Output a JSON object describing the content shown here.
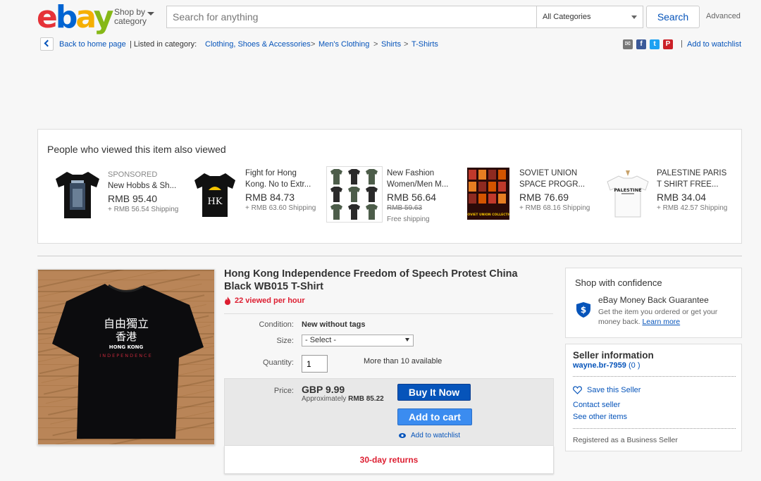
{
  "header": {
    "logo": [
      "e",
      "b",
      "a",
      "y"
    ],
    "shop_by_line1": "Shop by",
    "shop_by_line2": "category",
    "search_placeholder": "Search for anything",
    "category": "All Categories",
    "search_button": "Search",
    "advanced": "Advanced"
  },
  "breadcrumb": {
    "back": "Back to home page",
    "listed_in": "| Listed in category:",
    "items": [
      "Clothing, Shoes & Accessories",
      "Men's Clothing",
      "Shirts",
      "T-Shirts"
    ],
    "separator": ">",
    "add_to_watchlist": "Add to watchlist",
    "pipe": "|"
  },
  "share_icons": [
    {
      "name": "email-icon",
      "glyph": "✉",
      "color": "#777777"
    },
    {
      "name": "facebook-icon",
      "glyph": "f",
      "color": "#3b5998"
    },
    {
      "name": "twitter-icon",
      "glyph": "t",
      "color": "#1da1f2"
    },
    {
      "name": "pinterest-icon",
      "glyph": "P",
      "color": "#cb2027"
    }
  ],
  "also_viewed": {
    "title": "People who viewed this item also viewed",
    "items": [
      {
        "label": "SPONSORED",
        "line1": "New Hobbs & Sh...",
        "line2": "",
        "price": "RMB 95.40",
        "strike": "",
        "shipping": "+ RMB 56.54 Shipping"
      },
      {
        "label": "",
        "line1": "Fight for Hong",
        "line2": "Kong. No to Extr...",
        "price": "RMB 84.73",
        "strike": "",
        "shipping": "+ RMB 63.60 Shipping"
      },
      {
        "label": "",
        "line1": "New Fashion",
        "line2": "Women/Men M...",
        "price": "RMB 56.64",
        "strike": "RMB 59.63",
        "shipping": "Free shipping"
      },
      {
        "label": "",
        "line1": "SOVIET UNION",
        "line2": "SPACE PROGR...",
        "price": "RMB 76.69",
        "strike": "",
        "shipping": "+ RMB 68.16 Shipping"
      },
      {
        "label": "",
        "line1": "PALESTINE PARIS",
        "line2": "T SHIRT FREE...",
        "price": "RMB 34.04",
        "strike": "",
        "shipping": "+ RMB 42.57 Shipping"
      }
    ],
    "thumb_text": {
      "hk": "HK",
      "soviet": "SOVIET UNION COLLECTION",
      "palestine": "PALESTINE"
    }
  },
  "product": {
    "image_text": {
      "line1": "自由獨立",
      "line2": "香港",
      "line3": "HONG KONG",
      "line4": "INDEPENDENCE"
    },
    "title": "Hong Kong Independence Freedom of Speech Protest China Black WB015 T-Shirt",
    "views": "22 viewed per hour",
    "condition_label": "Condition:",
    "condition_value": "New without tags",
    "size_label": "Size:",
    "size_value": "- Select -",
    "quantity_label": "Quantity:",
    "quantity_value": "1",
    "availability": "More than 10 available",
    "price_label": "Price:",
    "price_value": "GBP 9.99",
    "price_approx_prefix": "Approximately",
    "price_approx_value": "RMB 85.22",
    "buy_now": "Buy It Now",
    "add_to_cart": "Add to cart",
    "add_to_watchlist": "Add to watchlist",
    "returns": "30-day returns"
  },
  "confidence": {
    "title": "Shop with confidence",
    "mbg_title": "eBay Money Back Guarantee",
    "mbg_desc": "Get the item you ordered or get your money back.",
    "learn_more": "Learn more"
  },
  "seller": {
    "title": "Seller information",
    "name": "wayne.br-7959",
    "score": "(0 )",
    "save": "Save this Seller",
    "contact": "Contact seller",
    "other_items": "See other items",
    "business": "Registered as a Business Seller"
  },
  "colors": {
    "ebay_red": "#e53238",
    "ebay_blue": "#0064d2",
    "ebay_yellow": "#f5af02",
    "ebay_green": "#86b817",
    "link": "#0654ba",
    "alert_red": "#dd1e31"
  }
}
